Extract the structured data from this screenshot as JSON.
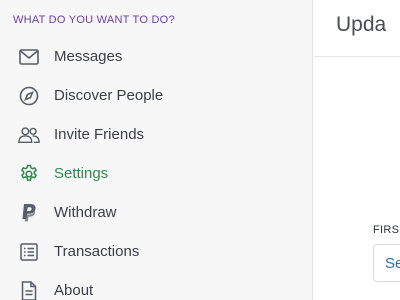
{
  "sidebar": {
    "section_title": "WHAT DO YOU WANT TO DO?",
    "items": [
      {
        "label": "Messages",
        "icon": "envelope-icon",
        "active": false
      },
      {
        "label": "Discover People",
        "icon": "compass-icon",
        "active": false
      },
      {
        "label": "Invite Friends",
        "icon": "people-icon",
        "active": false
      },
      {
        "label": "Settings",
        "icon": "gear-icon",
        "active": true
      },
      {
        "label": "Withdraw",
        "icon": "paypal-icon",
        "active": false
      },
      {
        "label": "Transactions",
        "icon": "list-icon",
        "active": false
      },
      {
        "label": "About",
        "icon": "document-icon",
        "active": false
      }
    ]
  },
  "main": {
    "title": "Upda",
    "field_label": "FIRS",
    "field_value": "Se"
  },
  "colors": {
    "accent_green": "#2b8a4f",
    "section_purple": "#6a3db0",
    "link_blue": "#2a6fb0"
  }
}
